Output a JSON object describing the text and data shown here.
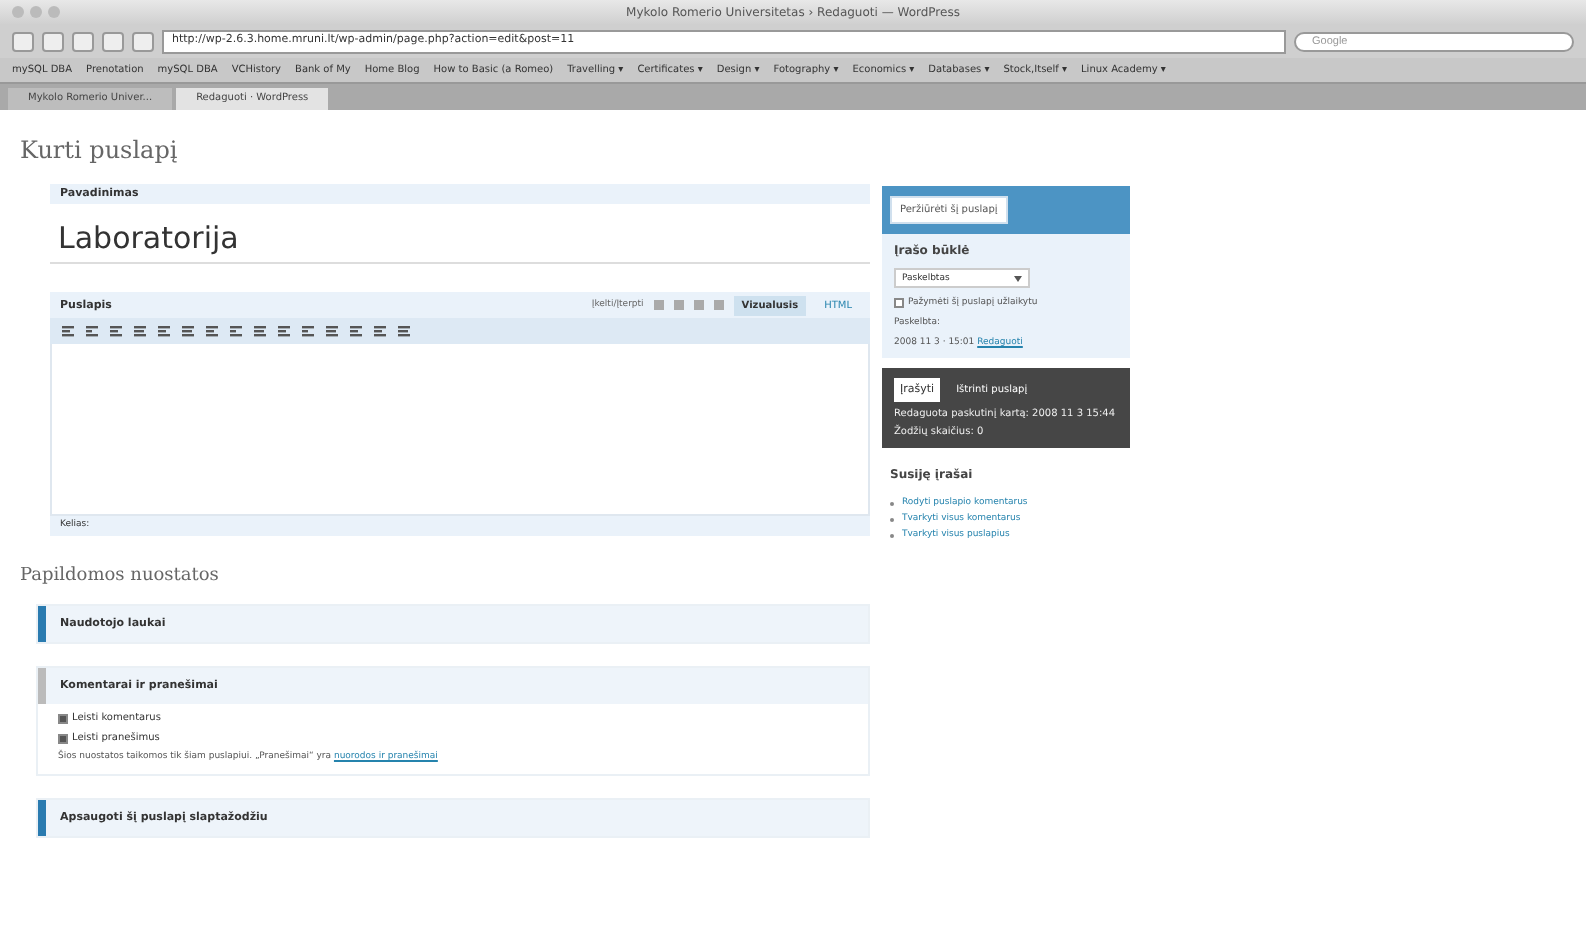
{
  "window": {
    "title": "Mykolo Romerio Universitetas › Redaguoti — WordPress"
  },
  "address_bar": {
    "url": "http://wp-2.6.3.home.mruni.lt/wp-admin/page.php?action=edit&post=11"
  },
  "search": {
    "placeholder": "Google"
  },
  "bookmarks": [
    "mySQL DBA",
    "Prenotation",
    "mySQL DBA",
    "VCHistory",
    "Bank of My",
    "Home Blog",
    "How to Basic (a Romeo)",
    "Travelling ▾",
    "Certificates ▾",
    "Design ▾",
    "Fotography ▾",
    "Economics ▾",
    "Databases ▾",
    "Stock,Itself ▾",
    "Linux Academy ▾"
  ],
  "browser_tabs": [
    {
      "label": "Mykolo Romerio Univer...",
      "selected": false
    },
    {
      "label": "Redaguoti · WordPress",
      "selected": true
    }
  ],
  "page_title": "Kurti puslapį",
  "title_box": {
    "label": "Pavadinimas",
    "value": "Laboratorija"
  },
  "editor": {
    "label": "Puslapis",
    "upload_label": "Įkelti/Įterpti",
    "modes": [
      {
        "label": "Vizualusis",
        "selected": true
      },
      {
        "label": "HTML",
        "selected": false
      }
    ],
    "path_label": "Kelias:"
  },
  "extra_title": "Papildomos nuostatos",
  "sections": [
    {
      "title": "Naudotojo laukai",
      "expanded": false
    },
    {
      "title": "Komentarai ir pranešimai",
      "expanded": true,
      "options": [
        {
          "label": "Leisti komentarus",
          "checked": true
        },
        {
          "label": "Leisti pranešimus",
          "checked": true
        }
      ],
      "note": "Šios nuostatos taikomos tik šiam puslapiui. „Pranešimai“ yra ",
      "note_link": "nuorodos ir pranešimai"
    },
    {
      "title": "Apsaugoti šį puslapį slaptažodžiu",
      "expanded": false
    }
  ],
  "publish": {
    "preview_button": "Peržiūrėti šį puslapį",
    "status_title": "Įrašo būklė",
    "status_value": "Paskelbtas",
    "pending": {
      "label": "Pažymėti šį puslapį užlaikytu",
      "checked": false
    },
    "published_label": "Paskelbta:",
    "published_date": "2008 11 3 · 15:01",
    "edit_link": "Redaguoti",
    "save_button": "Įrašyti",
    "delete_link": "Ištrinti puslapį",
    "last_edited": "Redaguota paskutinį kartą: 2008 11 3 15:44",
    "word_count": "Žodžių skaičius: 0"
  },
  "related": {
    "title": "Susiję įrašai",
    "links": [
      "Rodyti puslapio komentarus",
      "Tvarkyti visus komentarus",
      "Tvarkyti visus puslapius"
    ]
  }
}
